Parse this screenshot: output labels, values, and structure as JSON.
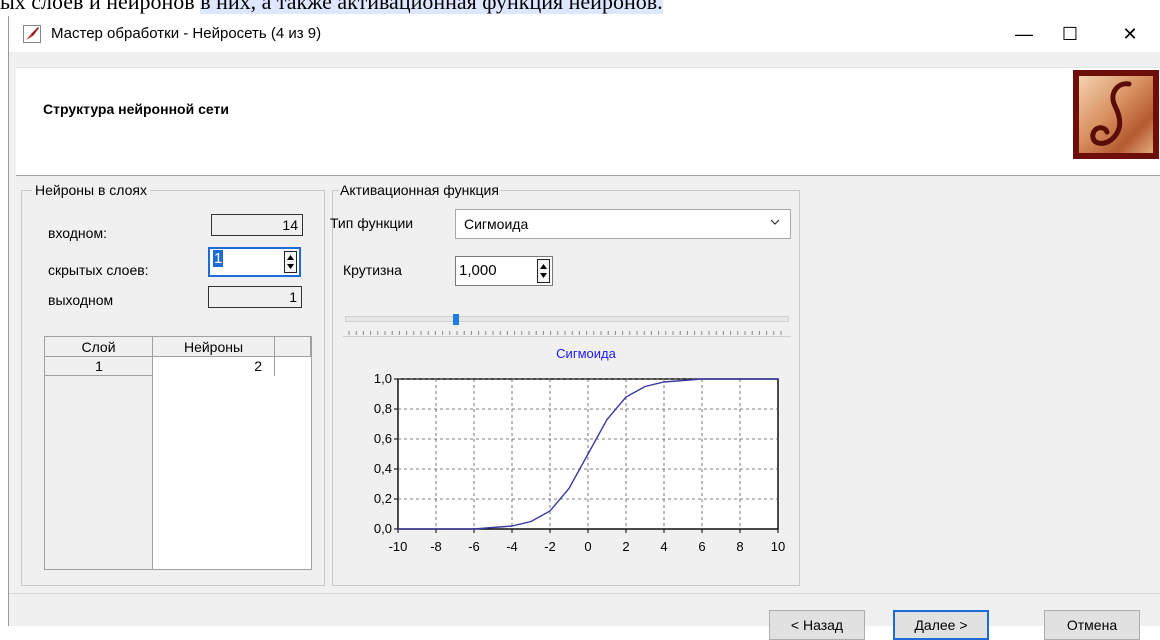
{
  "doc_background_text": {
    "before": "ых слоев и нейронов ",
    "highlight": "в них, а также активационная функция нейронов."
  },
  "window": {
    "title": "Мастер обработки - Нейросеть (4 из 9)",
    "minimize": "—",
    "maximize": "☐",
    "close": "✕"
  },
  "header": {
    "title": "Структура нейронной сети"
  },
  "neurons_group": {
    "label": "Нейроны в слоях",
    "input_label": "входном:",
    "input_value": "14",
    "hidden_label": "скрытых слоев:",
    "hidden_value": "1",
    "output_label": "выходном",
    "output_value": "1",
    "table": {
      "columns": [
        "Слой",
        "Нейроны"
      ],
      "rows": [
        {
          "layer": "1",
          "neurons": "2"
        }
      ]
    }
  },
  "activation_group": {
    "label": "Активационная функция",
    "type_label": "Тип функции",
    "type_value": "Сигмоида",
    "steepness_label": "Крутизна",
    "steepness_value": "1,000",
    "steepness_slider_fraction": 0.25
  },
  "chart_data": {
    "type": "line",
    "title": "Сигмоида",
    "xlabel": "",
    "ylabel": "",
    "xlim": [
      -10,
      10
    ],
    "ylim": [
      0,
      1
    ],
    "x_ticks": [
      "-10",
      "-8",
      "-6",
      "-4",
      "-2",
      "0",
      "2",
      "4",
      "6",
      "8",
      "10"
    ],
    "y_ticks": [
      "0,0",
      "0,2",
      "0,4",
      "0,6",
      "0,8",
      "1,0"
    ],
    "grid": true,
    "series": [
      {
        "x": [
          -10,
          -9,
          -8,
          -7,
          -6,
          -5,
          -4,
          -3,
          -2,
          -1,
          0,
          1,
          2,
          3,
          4,
          5,
          6,
          7,
          8,
          9,
          10
        ],
        "y": [
          0.0,
          0.0,
          0.0,
          0.0,
          0.0,
          0.01,
          0.02,
          0.05,
          0.12,
          0.27,
          0.5,
          0.73,
          0.88,
          0.95,
          0.98,
          0.99,
          1.0,
          1.0,
          1.0,
          1.0,
          1.0
        ]
      }
    ],
    "colors": {
      "line": "#3a3aa0",
      "title": "#1a1aff",
      "grid": "#555555"
    }
  },
  "buttons": {
    "back": "< Назад",
    "next": "Далее >",
    "cancel": "Отмена"
  }
}
